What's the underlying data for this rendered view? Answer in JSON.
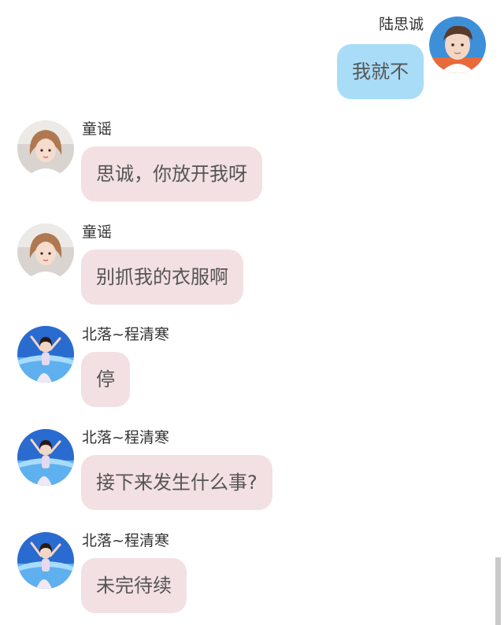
{
  "messages": [
    {
      "sender": "陆思诚",
      "text": "我就不",
      "side": "right",
      "avatar_icon": "avatar-boy-icon"
    },
    {
      "sender": "童谣",
      "text": "思诚，你放开我呀",
      "side": "left",
      "avatar_icon": "avatar-girl-brown-hair-icon"
    },
    {
      "sender": "童谣",
      "text": "别抓我的衣服啊",
      "side": "left",
      "avatar_icon": "avatar-girl-brown-hair-icon"
    },
    {
      "sender": "北落~程清寒",
      "text": "停",
      "side": "left",
      "avatar_icon": "avatar-girl-dancer-icon"
    },
    {
      "sender": "北落~程清寒",
      "text": "接下来发生什么事?",
      "side": "left",
      "avatar_icon": "avatar-girl-dancer-icon"
    },
    {
      "sender": "北落~程清寒",
      "text": "未完待续",
      "side": "left",
      "avatar_icon": "avatar-girl-dancer-icon"
    }
  ],
  "colors": {
    "incoming_bubble": "#f3e0e2",
    "outgoing_bubble": "#a9dcf7",
    "sender_name": "#333333",
    "message_text": "#555555"
  }
}
